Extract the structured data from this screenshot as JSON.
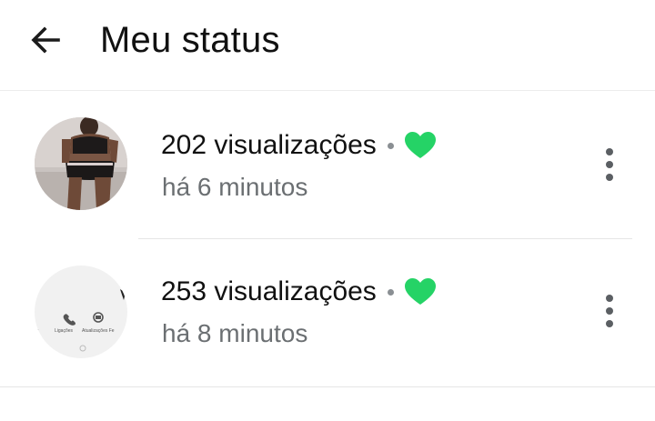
{
  "header": {
    "title": "Meu status",
    "back_icon": "arrow-left-icon"
  },
  "status_items": [
    {
      "views": "202 visualizações",
      "separator": "•",
      "reaction_icon": "green-heart-icon",
      "time": "há 6 minutos",
      "menu_icon": "more-vertical-icon",
      "thumbnail": "photo of person in black outfit"
    },
    {
      "views": "253 visualizações",
      "separator": "•",
      "reaction_icon": "green-heart-icon",
      "time": "há 8 minutos",
      "menu_icon": "more-vertical-icon",
      "thumbnail": "screenshot thumbnail",
      "thumbnail_text": [
        "Ligações",
        "Atualizações Fe"
      ]
    }
  ],
  "colors": {
    "heart": "#25D366",
    "secondary_text": "#6b6f72",
    "divider": "#e6e6e6"
  }
}
